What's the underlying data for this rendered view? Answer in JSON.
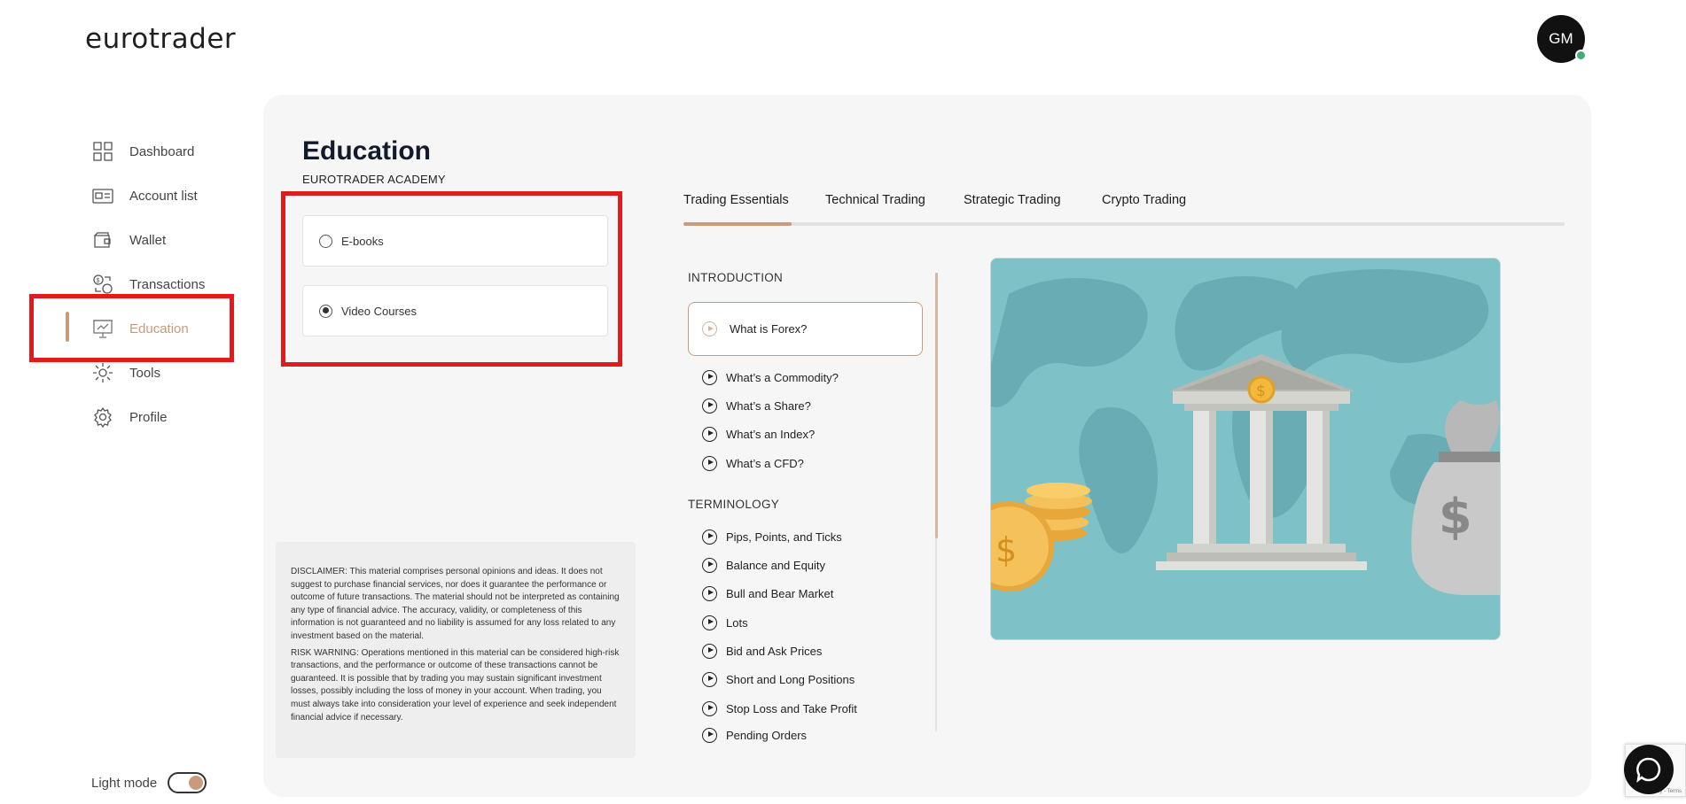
{
  "brand": {
    "logo_text": "eurotrader"
  },
  "user": {
    "initials": "GM",
    "online_color": "#3fae74"
  },
  "sidebar": {
    "items": [
      {
        "label": "Dashboard",
        "icon": "grid-icon"
      },
      {
        "label": "Account list",
        "icon": "id-card-icon"
      },
      {
        "label": "Wallet",
        "icon": "wallet-icon"
      },
      {
        "label": "Transactions",
        "icon": "exchange-icon"
      },
      {
        "label": "Education",
        "icon": "presentation-board-icon",
        "active": true
      },
      {
        "label": "Tools",
        "icon": "tools-gear-icon"
      },
      {
        "label": "Profile",
        "icon": "settings-gear-icon"
      }
    ],
    "light_mode_label": "Light mode",
    "light_mode_on": true
  },
  "page": {
    "title": "Education",
    "subtitle": "EUROTRADER ACADEMY"
  },
  "content_types": [
    {
      "label": "E-books",
      "selected": false
    },
    {
      "label": "Video Courses",
      "selected": true
    }
  ],
  "disclaimer": {
    "paragraph1": "DISCLAIMER: This material comprises personal opinions and ideas. It does not suggest to purchase financial services, nor does it guarantee the performance or outcome of future transactions. The material should not be interpreted as containing any type of financial advice. The accuracy, validity, or completeness of this information is not guaranteed and no liability is assumed for any loss related to any investment based on the material.",
    "paragraph2": "RISK WARNING: Operations mentioned in this material can be considered high-risk transactions, and the performance or outcome of these transactions cannot be guaranteed. It is possible that by trading you may sustain significant investment losses, possibly including the loss of money in your account. When trading, you must always take into consideration your level of experience and seek independent financial advice if necessary."
  },
  "tabs": [
    {
      "label": "Trading Essentials",
      "active": true
    },
    {
      "label": "Technical Trading"
    },
    {
      "label": "Strategic Trading"
    },
    {
      "label": "Crypto Trading"
    }
  ],
  "lessons": {
    "introduction_label": "INTRODUCTION",
    "active_lesson": "What is Forex?",
    "introduction": [
      "What’s a Commodity?",
      "What’s a Share?",
      "What’s an Index?",
      "What’s a CFD?"
    ],
    "terminology_label": "TERMINOLOGY",
    "terminology": [
      "Pips, Points, and Ticks",
      "Balance and Equity",
      "Bull and Bear Market",
      "Lots",
      "Bid and Ask Prices",
      "Short and Long Positions",
      "Stop Loss and Take Profit",
      "Pending Orders"
    ]
  },
  "colors": {
    "accent": "#c99b7d",
    "highlight": "#e01b1b",
    "video_background": "#7ec2c8"
  },
  "widgets": {
    "recaptcha_text": "Privacy - Terms"
  }
}
